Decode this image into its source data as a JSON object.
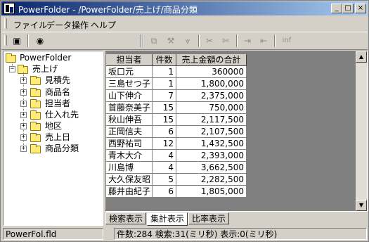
{
  "window": {
    "title": "PowerFolder - /PowerFolder/売上げ/商品分類",
    "minimize_icon": "minimize-icon",
    "maximize_icon": "maximize-icon",
    "close_icon": "close-icon"
  },
  "menu": {
    "items": [
      "ファイル",
      "データ操作",
      "ヘルプ"
    ]
  },
  "toolbar": {
    "info_label": "inf",
    "icons": [
      "chart-icon",
      "eye-icon",
      "copy-icon",
      "hammer-icon",
      "filter-icon",
      "scissors-icon",
      "cut-icon",
      "export-icon",
      "import-icon",
      "info-icon"
    ]
  },
  "tree": {
    "root": "PowerFolder",
    "branch": "売上げ",
    "children": [
      "見積先",
      "商品名",
      "担当者",
      "仕入れ先",
      "地区",
      "売上日",
      "商品分類"
    ]
  },
  "grid": {
    "headers": [
      "担当者",
      "件数",
      "売上金額の合計"
    ],
    "rows": [
      [
        "坂口元",
        "1",
        "360000"
      ],
      [
        "三島せつ子",
        "1",
        "1,800,000"
      ],
      [
        "山下伸介",
        "7",
        "2,375,000"
      ],
      [
        "首藤奈美子",
        "15",
        "750,000"
      ],
      [
        "秋山伸吾",
        "15",
        "2,117,500"
      ],
      [
        "正岡信夫",
        "6",
        "2,107,500"
      ],
      [
        "西野祐司",
        "12",
        "1,432,500"
      ],
      [
        "青木大介",
        "4",
        "2,393,000"
      ],
      [
        "川島博",
        "4",
        "3,662,500"
      ],
      [
        "大久保友昭",
        "5",
        "2,282,500"
      ],
      [
        "藤井由紀子",
        "6",
        "1,805,000"
      ]
    ]
  },
  "tabs": [
    "検索表示",
    "集計表示",
    "比率表示"
  ],
  "active_tab": "集計表示",
  "status": {
    "file": "PowerFol.fld",
    "info": "件数:284  検索:31(ミリ秒)  表示:0(ミリ秒)"
  }
}
